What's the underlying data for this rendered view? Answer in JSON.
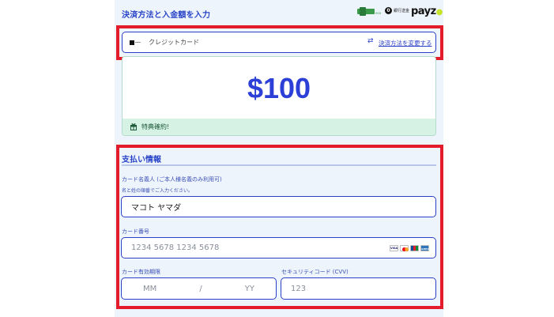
{
  "header": {
    "title": "決済方法と入金額を入力",
    "logos": [
      "ecopayz-logo",
      "bank-transfer-logo",
      "payz-logo"
    ],
    "bank_logo_text": "銀行送金",
    "payz_logo_text": "payz"
  },
  "payment_method": {
    "label": "クレジットカード",
    "change_link": "決済方法を変更する"
  },
  "amount": {
    "value": "$100",
    "benefit_text": "特典確約!"
  },
  "payment_info": {
    "title": "支払い情報",
    "cardholder": {
      "label": "カード名義人 (ご本人様名義のみ利用可)",
      "hint": "名と姓の順番でご入力ください。",
      "value": "マコト ヤマダ"
    },
    "card_number": {
      "label": "カード番号",
      "placeholder": "1234 5678 1234 5678",
      "brands": [
        "visa",
        "mastercard",
        "jcb",
        "amex"
      ]
    },
    "expiry": {
      "label": "カード有効期限",
      "month_placeholder": "MM",
      "separator": "/",
      "year_placeholder": "YY"
    },
    "cvv": {
      "label": "セキュリティコード (CVV)",
      "placeholder": "123"
    }
  },
  "colors": {
    "accent": "#2b3fc7",
    "highlight": "#e41b2a",
    "benefit_bg": "#d6f2e5",
    "panel_bg": "#eef4fb"
  }
}
